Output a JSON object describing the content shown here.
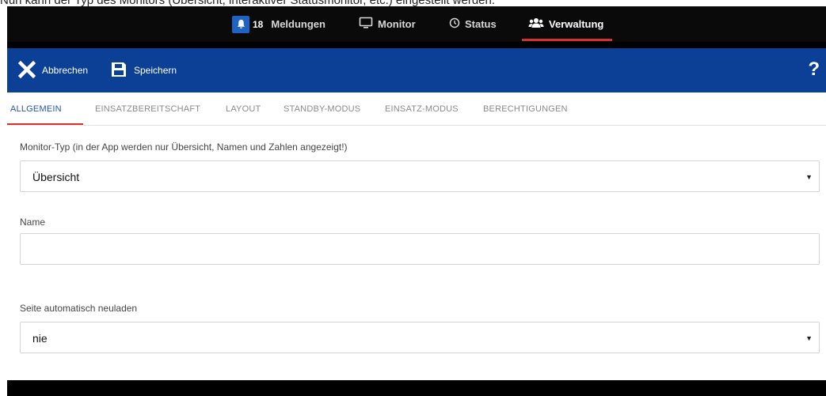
{
  "caption": "Nun kann der Typ des Monitors (Übersicht, interaktiver Statusmonitor, etc.) eingestellt werden.",
  "nav": {
    "badge_count": "18",
    "items": [
      {
        "label": "Meldungen"
      },
      {
        "label": "Monitor"
      },
      {
        "label": "Status"
      },
      {
        "label": "Verwaltung"
      }
    ],
    "active_color": "#d0342c"
  },
  "toolbar": {
    "cancel_label": "Abbrechen",
    "save_label": "Speichern",
    "help_label": "?",
    "color": "#0c3f96"
  },
  "tabs": [
    {
      "label": "ALLGEMEIN"
    },
    {
      "label": "EINSATZBEREITSCHAFT"
    },
    {
      "label": "LAYOUT"
    },
    {
      "label": "STANDBY-MODUS"
    },
    {
      "label": "EINSATZ-MODUS"
    },
    {
      "label": "BERECHTIGUNGEN"
    }
  ],
  "form": {
    "monitor_type": {
      "label": "Monitor-Typ (in der App werden nur Übersicht, Namen und Zahlen angezeigt!)",
      "value": "Übersicht"
    },
    "name": {
      "label": "Name",
      "value": ""
    },
    "reload": {
      "label": "Seite automatisch neuladen",
      "value": "nie"
    }
  }
}
